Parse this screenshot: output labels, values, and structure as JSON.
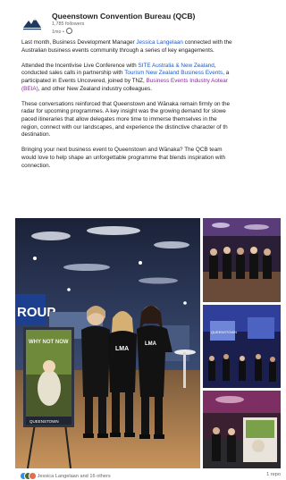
{
  "post": {
    "author": "Queenstown Convention Bureau (QCB)",
    "followers": "1,785 followers",
    "time": "1mo •"
  },
  "body": {
    "p1": {
      "a": "Last month, Business Development Manager ",
      "link_name": "Jessica Langelaan",
      "b": " connected with the",
      "l2": "Australian business events community through a series of key engagements."
    },
    "p2": {
      "a": "Attended the Incentivise Live Conference with ",
      "link_site": "SITE Australia & New Zealand",
      "b": ",",
      "c": "conducted sales calls in partnership with ",
      "link_tnz": "Tourism New Zealand Business Events",
      "d": ", a",
      "e": "participated in Events Uncovered, joined by TNZ, ",
      "link_beia": "Business Events Industry Aotear",
      "link_beia2": "(BEIA)",
      "f": ", and other New Zealand industry colleagues."
    },
    "p3": {
      "l1": "These conversations reinforced that Queenstown and Wānaka remain firmly on the",
      "l2": "radar for upcoming programmes. A key insight was the growing demand for slowe",
      "l3": "paced itineraries that allow delegates more time to immerse themselves in the",
      "l4": "region, connect with our landscapes, and experience the distinctive character of th",
      "l5": "destination."
    },
    "p4": {
      "l1": "Bringing your next business event to Queenstown and Wānaka? The QCB team",
      "l2": "would love to help shape an unforgettable programme that blends inspiration with",
      "l3": "connection."
    }
  },
  "photos": {
    "main": {
      "banner_text": "ROUP",
      "poster_text": "WHY NOT NOW",
      "poster_footer": "QUEENSTOWN",
      "shirt_text": "LMA"
    },
    "side_screen_text": "QUEENSTOWN"
  },
  "footer": {
    "reactions": "Jessica Langelaan and 16 others",
    "reposts": "1 repo"
  },
  "colors": {
    "link": "#1a5bd1",
    "link_purple": "#8a2aa3",
    "like": "#378fe9",
    "celebrate": "#44712e",
    "love": "#df704d"
  }
}
